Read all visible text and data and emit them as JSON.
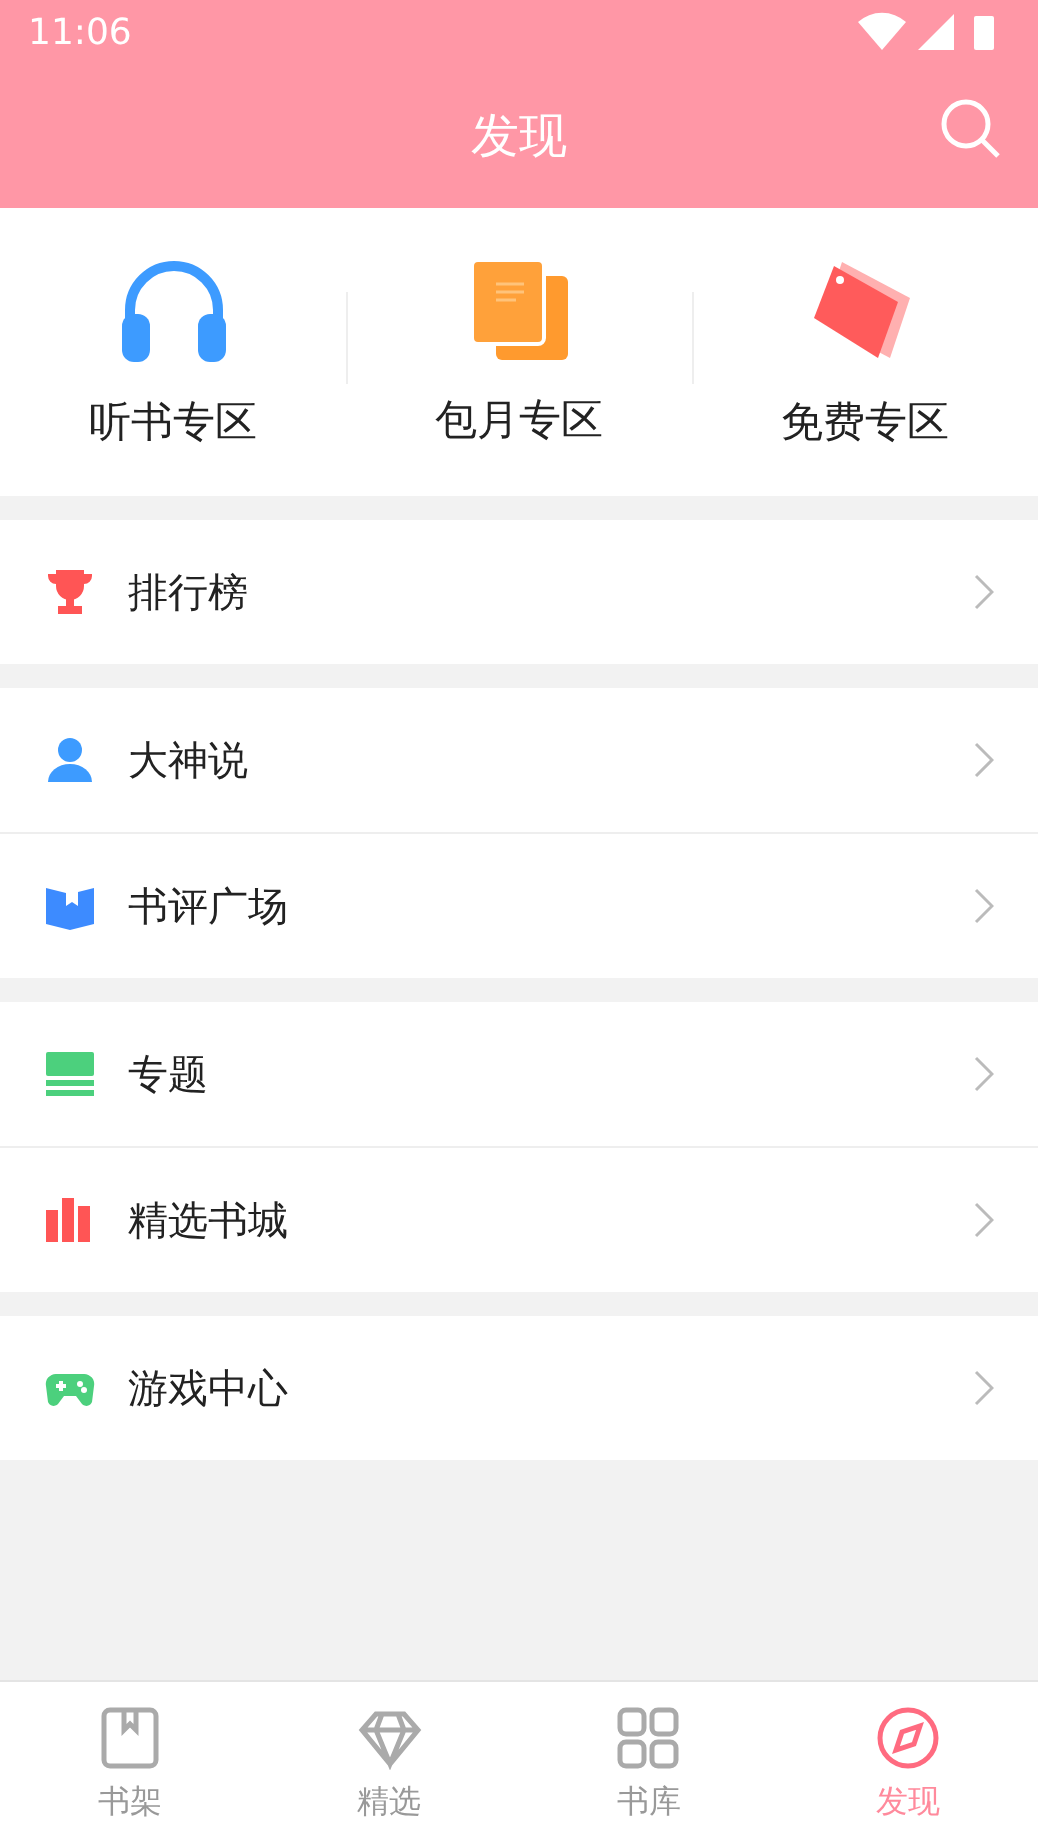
{
  "status_bar": {
    "time": "11:06"
  },
  "header": {
    "title": "发现"
  },
  "zones": [
    {
      "kind": "headphones",
      "label": "听书专区"
    },
    {
      "kind": "books",
      "label": "包月专区"
    },
    {
      "kind": "tag",
      "label": "免费专区"
    }
  ],
  "groups": [
    {
      "items": [
        {
          "kind": "trophy",
          "label": "排行榜"
        }
      ]
    },
    {
      "items": [
        {
          "kind": "person",
          "label": "大神说"
        },
        {
          "kind": "review",
          "label": "书评广场"
        }
      ]
    },
    {
      "items": [
        {
          "kind": "layers",
          "label": "专题"
        },
        {
          "kind": "shelf",
          "label": "精选书城"
        }
      ]
    },
    {
      "items": [
        {
          "kind": "gamepad",
          "label": "游戏中心"
        }
      ]
    }
  ],
  "tabs": [
    {
      "kind": "shelf",
      "label": "书架",
      "selected": false
    },
    {
      "kind": "gem",
      "label": "精选",
      "selected": false
    },
    {
      "kind": "grid",
      "label": "书库",
      "selected": false
    },
    {
      "kind": "compass",
      "label": "发现",
      "selected": true
    }
  ]
}
